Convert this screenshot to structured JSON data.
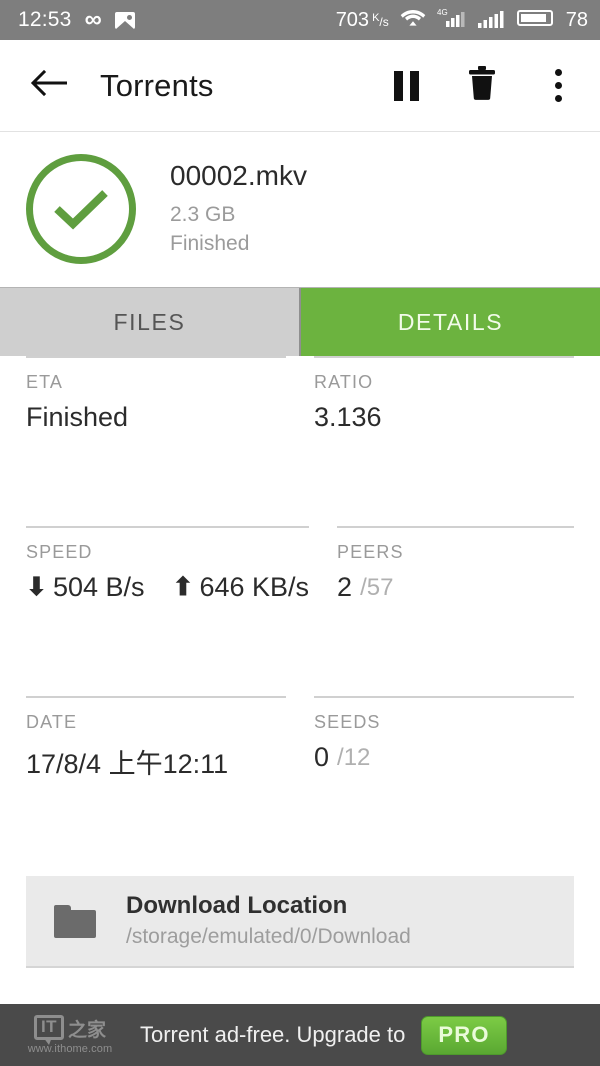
{
  "statusbar": {
    "time": "12:53",
    "infinity_icon": "infinity-icon",
    "photo_icon": "photo-icon",
    "net_speed": "703",
    "net_speed_unit_top": "K",
    "net_speed_unit_bottom": "s",
    "wifi_icon": "wifi-icon",
    "signal_4g_label": "4G",
    "signal_icon": "signal-bars-icon",
    "battery_level": "78"
  },
  "toolbar": {
    "back_icon": "back-arrow-icon",
    "title": "Torrents",
    "pause_icon": "pause-icon",
    "delete_icon": "trash-icon",
    "overflow_icon": "more-vertical-icon"
  },
  "torrent": {
    "status_icon": "check-circle-icon",
    "name": "00002.mkv",
    "size": "2.3 GB",
    "state": "Finished",
    "accent_green": "#5f9e3f"
  },
  "tabs": [
    {
      "label": "FILES",
      "active": false
    },
    {
      "label": "DETAILS",
      "active": true
    }
  ],
  "tab_active_color": "#6cb33f",
  "details": {
    "eta": {
      "label": "ETA",
      "value": "Finished"
    },
    "ratio": {
      "label": "RATIO",
      "value": "3.136"
    },
    "speed": {
      "label": "SPEED",
      "download_arrow": "arrow-down-icon",
      "download": "504 B/s",
      "upload_arrow": "arrow-up-icon",
      "upload": "646 KB/s"
    },
    "peers": {
      "label": "PEERS",
      "value": "2",
      "total": "/57"
    },
    "date": {
      "label": "DATE",
      "value": "17/8/4 上午12:11"
    },
    "seeds": {
      "label": "SEEDS",
      "value": "0",
      "total": "/12"
    }
  },
  "download_location": {
    "folder_icon": "folder-icon",
    "title": "Download Location",
    "path": "/storage/emulated/0/Download"
  },
  "ad_banner": {
    "watermark_mark": "IT",
    "watermark_cn": "之家",
    "watermark_url": "www.ithome.com",
    "text": "Torrent ad-free. Upgrade to",
    "pro_label": "PRO",
    "pro_color": "#6cb33f"
  }
}
